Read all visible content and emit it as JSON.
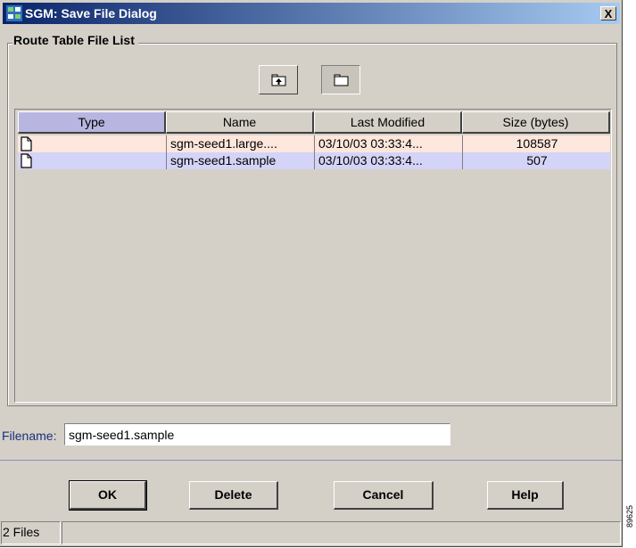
{
  "window": {
    "title": "SGM: Save File Dialog",
    "close_label": "X"
  },
  "group": {
    "label": "Route Table File List"
  },
  "toolbar": {
    "buttons": [
      {
        "icon": "up-folder-icon"
      },
      {
        "icon": "new-folder-icon"
      }
    ]
  },
  "table": {
    "columns": [
      "Type",
      "Name",
      "Last Modified",
      "Size (bytes)"
    ],
    "rows": [
      {
        "type_icon": "file-icon",
        "name": "sgm-seed1.large....",
        "last_modified": "03/10/03  03:33:4...",
        "size": "108587"
      },
      {
        "type_icon": "file-icon",
        "name": "sgm-seed1.sample",
        "last_modified": "03/10/03  03:33:4...",
        "size": "507"
      }
    ],
    "colors": {
      "sorted_header": "#b8b6e0",
      "row_1": "#fde6dc",
      "row_2": "#d4d4f8"
    }
  },
  "filename": {
    "label": "Filename:",
    "value": "sgm-seed1.sample"
  },
  "buttons": {
    "ok": "OK",
    "delete": "Delete",
    "cancel": "Cancel",
    "help": "Help"
  },
  "status": {
    "text": "2 Files",
    "extra": ""
  },
  "side_text": "89625"
}
